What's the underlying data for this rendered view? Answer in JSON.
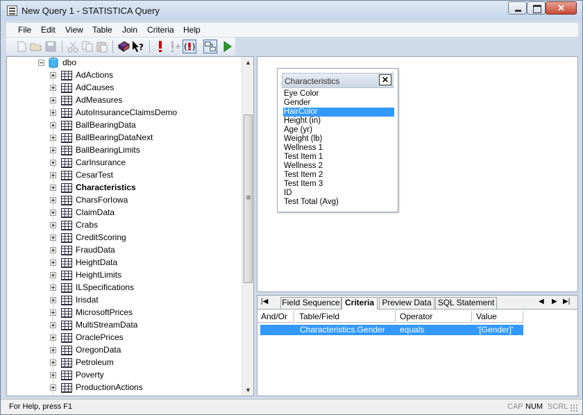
{
  "window": {
    "title": "New Query 1 - STATISTICA Query"
  },
  "menu": [
    "File",
    "Edit",
    "View",
    "Table",
    "Join",
    "Criteria",
    "Help"
  ],
  "tree": {
    "root_label": "dbo",
    "selected": "Characteristics",
    "items": [
      "AdActions",
      "AdCauses",
      "AdMeasures",
      "AutoInsuranceClaimsDemo",
      "BallBearingData",
      "BallBearingDataNext",
      "BallBearingLimits",
      "CarInsurance",
      "CesarTest",
      "Characteristics",
      "CharsForIowa",
      "ClaimData",
      "Crabs",
      "CreditScoring",
      "FraudData",
      "HeightData",
      "HeightLimits",
      "ILSpecifications",
      "Irisdat",
      "MicrosoftPrices",
      "MultiStreamData",
      "OraclePrices",
      "OregonData",
      "Petroleum",
      "Poverty",
      "ProductionActions"
    ]
  },
  "table_window": {
    "title": "Characteristics",
    "fields": [
      "Eye Color",
      "Gender",
      "HairColor",
      "Height (in)",
      "Age (yr)",
      "Weight (lb)",
      "Wellness 1",
      "Test Item 1",
      "Wellness 2",
      "Test Item 2",
      "Test Item 3",
      "ID",
      "Test Total (Avg)"
    ],
    "selected_field": "HairColor"
  },
  "grid": {
    "tabs": [
      "Field Sequence",
      "Criteria",
      "Preview Data",
      "SQL Statement"
    ],
    "active_tab": "Criteria",
    "columns": [
      "And/Or",
      "Table/Field",
      "Operator",
      "Value"
    ],
    "rows": [
      {
        "and_or": "",
        "table_field": "Characteristics.Gender",
        "operator": "equals",
        "value": "'[Gender]'"
      }
    ]
  },
  "status": {
    "text": "For Help, press F1",
    "indicators": [
      {
        "label": "CAP",
        "active": false
      },
      {
        "label": "NUM",
        "active": true
      },
      {
        "label": "SCRL",
        "active": false
      }
    ]
  },
  "colors": {
    "selection": "#3399ff",
    "frame": "#cfdbe9"
  },
  "toolbar_icons": [
    "new-icon",
    "open-icon",
    "save-icon",
    "cut-icon",
    "copy-icon",
    "paste-icon",
    "add-table-icon",
    "context-help-icon",
    "exclamation-icon",
    "criteria-plus-icon",
    "exclamation-circle-icon",
    "join-icon",
    "run-icon"
  ]
}
